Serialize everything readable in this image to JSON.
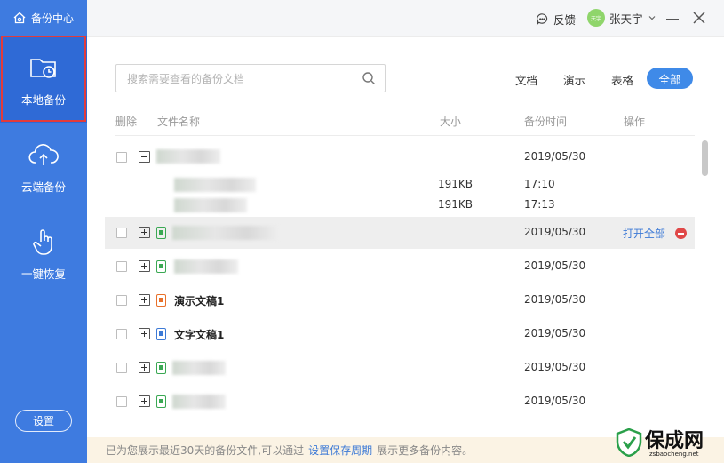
{
  "sidebar": {
    "brand": "备份中心",
    "items": [
      {
        "label": "本地备份",
        "icon": "folder-clock-icon"
      },
      {
        "label": "云端备份",
        "icon": "cloud-upload-icon"
      },
      {
        "label": "一键恢复",
        "icon": "hand-pointer-icon"
      }
    ],
    "settings_label": "设置"
  },
  "header": {
    "feedback_label": "反馈",
    "user_name": "张天宇",
    "avatar_text": "天宇"
  },
  "search": {
    "placeholder": "搜索需要查看的备份文档"
  },
  "filters": [
    "文档",
    "演示",
    "表格",
    "全部"
  ],
  "columns": {
    "delete": "删除",
    "name": "文件名称",
    "size": "大小",
    "time": "备份时间",
    "action": "操作"
  },
  "rows": [
    {
      "name": "",
      "date": "2019/05/30",
      "expanded": true,
      "icon": "none"
    },
    {
      "name": "",
      "date": "2019/05/30",
      "icon": "spreadsheet-icon",
      "action": "打开全部"
    },
    {
      "name": "",
      "date": "2019/05/30",
      "icon": "spreadsheet-icon"
    },
    {
      "name": "演示文稿1",
      "date": "2019/05/30",
      "icon": "presentation-icon"
    },
    {
      "name": "文字文稿1",
      "date": "2019/05/30",
      "icon": "document-icon"
    },
    {
      "name": "",
      "date": "2019/05/30",
      "icon": "spreadsheet-icon"
    },
    {
      "name": "",
      "date": "2019/05/30",
      "icon": "spreadsheet-icon"
    }
  ],
  "subrows": [
    {
      "size": "191KB",
      "time": "17:10"
    },
    {
      "size": "191KB",
      "time": "17:13"
    }
  ],
  "footer": {
    "prefix": "已为您展示最近30天的备份文件,可以通过",
    "link": "设置保存周期",
    "suffix": "展示更多备份内容。"
  },
  "watermark": {
    "text": "保成网",
    "url": "zsbaocheng.net"
  },
  "colors": {
    "sidebar": "#3e7be0",
    "accent": "#3f8ae8",
    "delete": "#e04848",
    "footer_bg": "#fbf3e4"
  }
}
